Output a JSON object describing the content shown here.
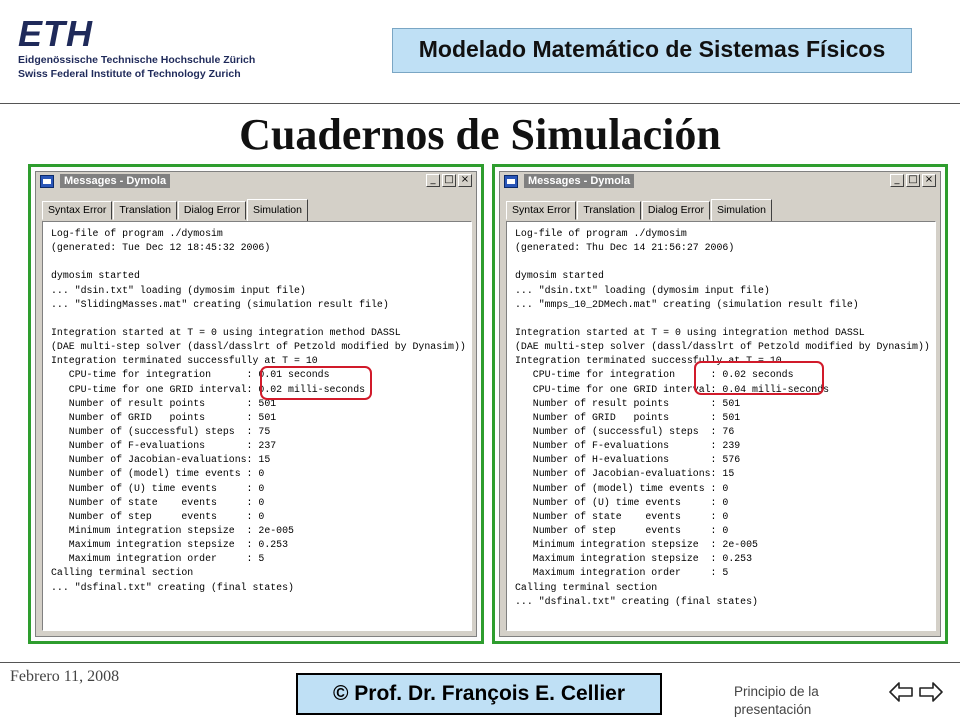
{
  "header": {
    "logo_mark": "ETH",
    "logo_line1": "Eidgenössische Technische Hochschule Zürich",
    "logo_line2": "Swiss Federal Institute of Technology Zurich",
    "course_title": "Modelado Matemático de Sistemas Físicos"
  },
  "page_title": "Cuadernos de Simulación",
  "windows": [
    {
      "title": "Messages - Dymola",
      "controls": [
        "_",
        "□",
        "×"
      ],
      "tabs": [
        "Syntax Error",
        "Translation",
        "Dialog Error",
        "Simulation"
      ],
      "active_tab": "Simulation",
      "log_lines": [
        "Log-file of program ./dymosim",
        "(generated: Tue Dec 12 18:45:32 2006)",
        "",
        "dymosim started",
        "... \"dsin.txt\" loading (dymosim input file)",
        "... \"SlidingMasses.mat\" creating (simulation result file)",
        "",
        "Integration started at T = 0 using integration method DASSL",
        "(DAE multi-step solver (dassl/dasslrt of Petzold modified by Dynasim))",
        "Integration terminated successfully at T = 10",
        "   CPU-time for integration      : 0.01 seconds",
        "   CPU-time for one GRID interval: 0.02 milli-seconds",
        "   Number of result points       : 501",
        "   Number of GRID   points       : 501",
        "   Number of (successful) steps  : 75",
        "   Number of F-evaluations       : 237",
        "   Number of Jacobian-evaluations: 15",
        "   Number of (model) time events : 0",
        "   Number of (U) time events     : 0",
        "   Number of state    events     : 0",
        "   Number of step     events     : 0",
        "   Minimum integration stepsize  : 2e-005",
        "   Maximum integration stepsize  : 0.253",
        "   Maximum integration order     : 5",
        "Calling terminal section",
        "... \"dsfinal.txt\" creating (final states)"
      ]
    },
    {
      "title": "Messages - Dymola",
      "controls": [
        "_",
        "□",
        "×"
      ],
      "tabs": [
        "Syntax Error",
        "Translation",
        "Dialog Error",
        "Simulation"
      ],
      "active_tab": "Simulation",
      "log_lines": [
        "Log-file of program ./dymosim",
        "(generated: Thu Dec 14 21:56:27 2006)",
        "",
        "dymosim started",
        "... \"dsin.txt\" loading (dymosim input file)",
        "... \"mmps_10_2DMech.mat\" creating (simulation result file)",
        "",
        "Integration started at T = 0 using integration method DASSL",
        "(DAE multi-step solver (dassl/dasslrt of Petzold modified by Dynasim))",
        "Integration terminated successfully at T = 10",
        "   CPU-time for integration      : 0.02 seconds",
        "   CPU-time for one GRID interval: 0.04 milli-seconds",
        "   Number of result points       : 501",
        "   Number of GRID   points       : 501",
        "   Number of (successful) steps  : 76",
        "   Number of F-evaluations       : 239",
        "   Number of H-evaluations       : 576",
        "   Number of Jacobian-evaluations: 15",
        "   Number of (model) time events : 0",
        "   Number of (U) time events     : 0",
        "   Number of state    events     : 0",
        "   Number of step     events     : 0",
        "   Minimum integration stepsize  : 2e-005",
        "   Maximum integration stepsize  : 0.253",
        "   Maximum integration order     : 5",
        "Calling terminal section",
        "... \"dsfinal.txt\" creating (final states)"
      ]
    }
  ],
  "footer": {
    "date": "Febrero 11, 2008",
    "credit": "© Prof. Dr. François E. Cellier",
    "link_line1": "Principio de la",
    "link_line2": "presentación",
    "nav_icons": [
      "arrow-left-icon",
      "arrow-right-icon"
    ]
  },
  "colors": {
    "panel_border": "#2e9d2e",
    "highlight": "#d11a2a",
    "box_fill": "#bfe0f5"
  }
}
